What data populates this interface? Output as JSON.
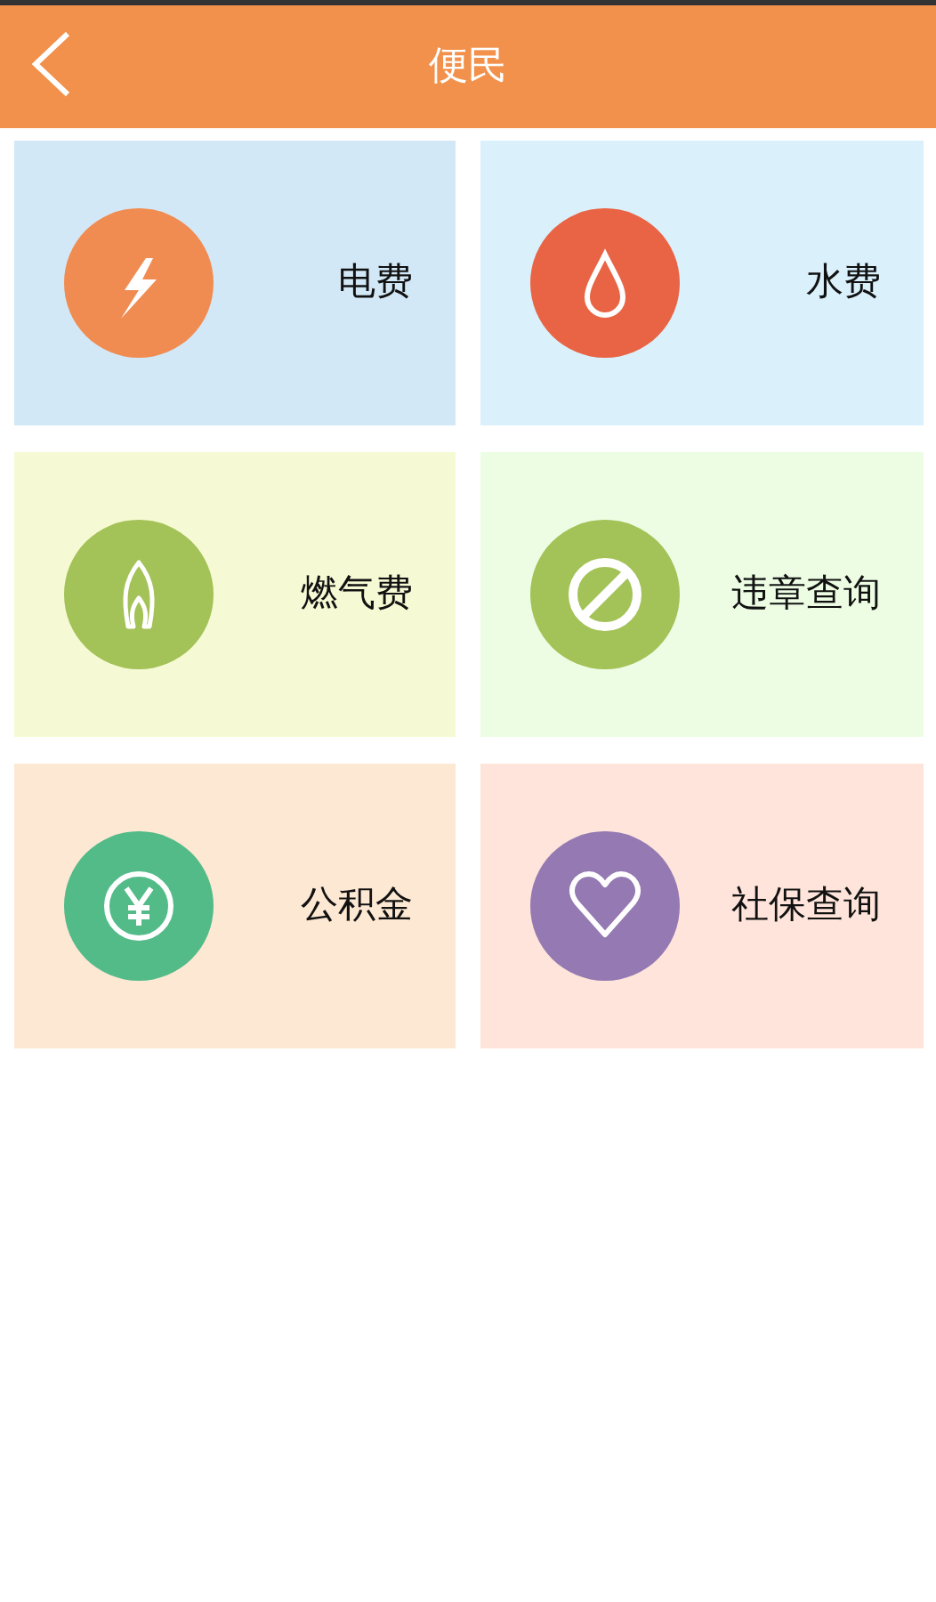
{
  "header": {
    "title": "便民"
  },
  "tiles": [
    {
      "label": "电费",
      "kind": "bolt",
      "color": "#f08c52"
    },
    {
      "label": "水费",
      "kind": "drop",
      "color": "#e86444"
    },
    {
      "label": "燃气费",
      "kind": "flame",
      "color": "#a3c257"
    },
    {
      "label": "违章查询",
      "kind": "ban",
      "color": "#a3c257"
    },
    {
      "label": "公积金",
      "kind": "yen",
      "color": "#52bb88"
    },
    {
      "label": "社保查询",
      "kind": "heart",
      "color": "#9479b2"
    }
  ]
}
